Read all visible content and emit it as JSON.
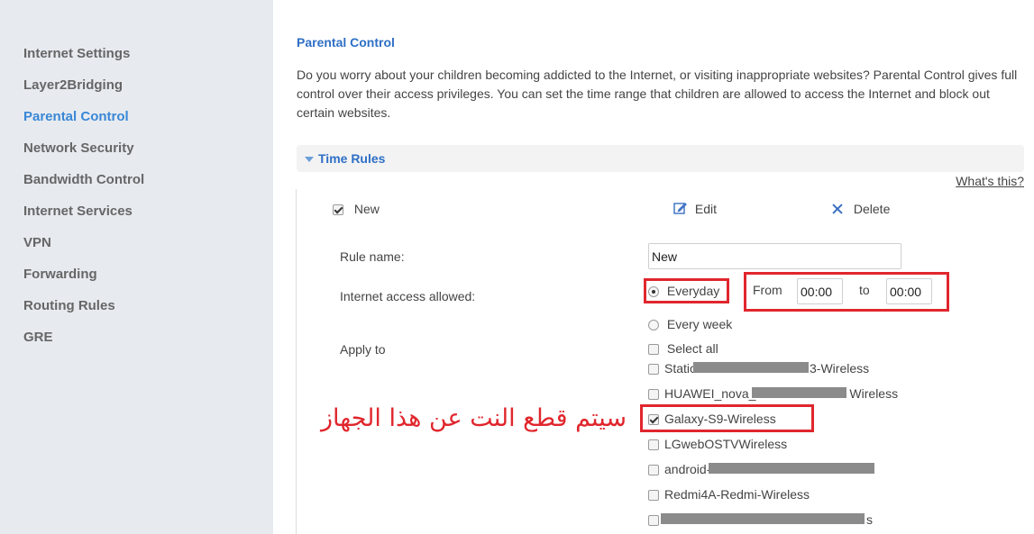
{
  "sidebar": {
    "items": [
      {
        "label": "Internet Settings",
        "active": false
      },
      {
        "label": "Layer2Bridging",
        "active": false
      },
      {
        "label": "Parental Control",
        "active": true
      },
      {
        "label": "Network Security",
        "active": false
      },
      {
        "label": "Bandwidth Control",
        "active": false
      },
      {
        "label": "Internet Services",
        "active": false
      },
      {
        "label": "VPN",
        "active": false
      },
      {
        "label": "Forwarding",
        "active": false
      },
      {
        "label": "Routing Rules",
        "active": false
      },
      {
        "label": "GRE",
        "active": false
      }
    ]
  },
  "main": {
    "title": "Parental Control",
    "description": "Do you worry about your children becoming addicted to the Internet, or visiting inappropriate websites? Parental Control gives full control over their access privileges. You can set the time range that children are allowed to access the Internet and block out certain websites.",
    "section_title": "Time Rules",
    "whats_this": "What's this?"
  },
  "rules_toolbar": {
    "new_label": "New",
    "edit_label": "Edit",
    "delete_label": "Delete"
  },
  "form": {
    "rule_name_label": "Rule name:",
    "rule_name_value": "New",
    "access_label": "Internet access allowed:",
    "everyday_label": "Everyday",
    "from_label": "From",
    "from_value": "00:00",
    "to_label": "to",
    "to_value": "00:00",
    "every_week_label": "Every week",
    "apply_to_label": "Apply to",
    "select_all_label": "Select all"
  },
  "devices": [
    {
      "prefix": "Static",
      "suffix": "3-Wireless",
      "checked": false
    },
    {
      "prefix": "HUAWEI_nova_",
      "suffix": "Wireless",
      "checked": false
    },
    {
      "prefix": "Galaxy-S9-Wireless",
      "suffix": "",
      "checked": true
    },
    {
      "prefix": "LGwebOSTVWireless",
      "suffix": "",
      "checked": false
    },
    {
      "prefix": "android-",
      "suffix": "",
      "checked": false
    },
    {
      "prefix": "Redmi4A-Redmi-Wireless",
      "suffix": "",
      "checked": false
    },
    {
      "prefix": "",
      "suffix": "s",
      "checked": false
    }
  ],
  "annotation": {
    "text": "سيتم قطع النت عن هذا الجهاز",
    "color": "#e0262d"
  },
  "colors": {
    "accent": "#3a87d6",
    "highlight_box": "#e0262d"
  }
}
